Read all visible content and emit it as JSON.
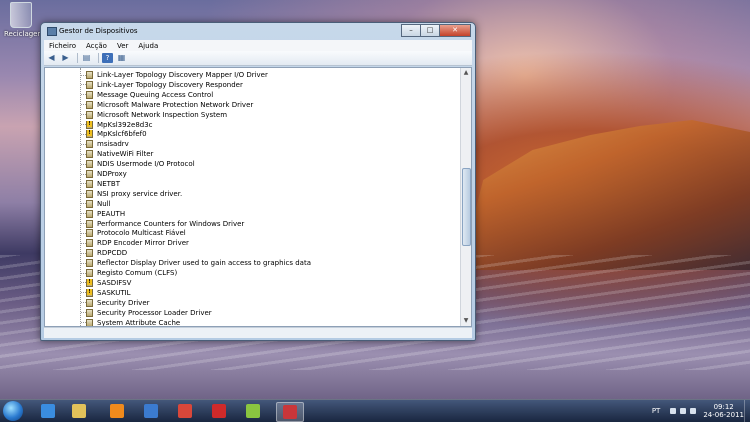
{
  "desktop": {
    "recycle_bin_label": "Reciclagem"
  },
  "window": {
    "title": "Gestor de Dispositivos",
    "minimize_glyph": "–",
    "maximize_glyph": "□",
    "close_glyph": "✕"
  },
  "menu": [
    "Ficheiro",
    "Acção",
    "Ver",
    "Ajuda"
  ],
  "toolbar_icons": [
    "back-icon",
    "forward-icon",
    "properties-icon",
    "help-icon",
    "scan-hardware-icon"
  ],
  "devices": [
    {
      "label": "Link-Layer Topology Discovery Mapper I/O Driver",
      "warn": false
    },
    {
      "label": "Link-Layer Topology Discovery Responder",
      "warn": false
    },
    {
      "label": "Message Queuing Access Control",
      "warn": false
    },
    {
      "label": "Microsoft Malware Protection Network Driver",
      "warn": false
    },
    {
      "label": "Microsoft Network Inspection System",
      "warn": false
    },
    {
      "label": "MpKsl392e8d3c",
      "warn": true
    },
    {
      "label": "MpKslcf6bfef0",
      "warn": true
    },
    {
      "label": "msisadrv",
      "warn": false
    },
    {
      "label": "NativeWiFi Filter",
      "warn": false
    },
    {
      "label": "NDIS Usermode I/O Protocol",
      "warn": false
    },
    {
      "label": "NDProxy",
      "warn": false
    },
    {
      "label": "NETBT",
      "warn": false
    },
    {
      "label": "NSI proxy service driver.",
      "warn": false
    },
    {
      "label": "Null",
      "warn": false
    },
    {
      "label": "PEAUTH",
      "warn": false
    },
    {
      "label": "Performance Counters for Windows Driver",
      "warn": false
    },
    {
      "label": "Protocolo Multicast Fiável",
      "warn": false
    },
    {
      "label": "RDP Encoder Mirror Driver",
      "warn": false
    },
    {
      "label": "RDPCDD",
      "warn": false
    },
    {
      "label": "Reflector Display Driver used to gain access to graphics data",
      "warn": false
    },
    {
      "label": "Registo Comum (CLFS)",
      "warn": false
    },
    {
      "label": "SASDIFSV",
      "warn": true
    },
    {
      "label": "SASKUTIL",
      "warn": true
    },
    {
      "label": "Security Driver",
      "warn": false
    },
    {
      "label": "Security Processor Loader Driver",
      "warn": false
    },
    {
      "label": "System Attribute Cache",
      "warn": false
    }
  ],
  "taskbar": {
    "items": [
      {
        "name": "internet-explorer-icon",
        "color": "#3a8de0",
        "active": false
      },
      {
        "name": "explorer-folder-icon",
        "color": "#e2c25a",
        "active": false
      },
      {
        "name": "media-player-icon",
        "color": "#f08a1c",
        "active": false
      },
      {
        "name": "network-app-icon",
        "color": "#3b7bd0",
        "active": false
      },
      {
        "name": "chrome-icon",
        "color": "#d9473a",
        "active": false
      },
      {
        "name": "antivirus-icon",
        "color": "#cf2a2a",
        "active": false
      },
      {
        "name": "utility-app-icon",
        "color": "#8ac640",
        "active": false
      },
      {
        "name": "device-manager-icon",
        "color": "#c8363a",
        "active": true
      }
    ],
    "language": "PT",
    "time": "09:12",
    "date": "24-06-2011"
  }
}
